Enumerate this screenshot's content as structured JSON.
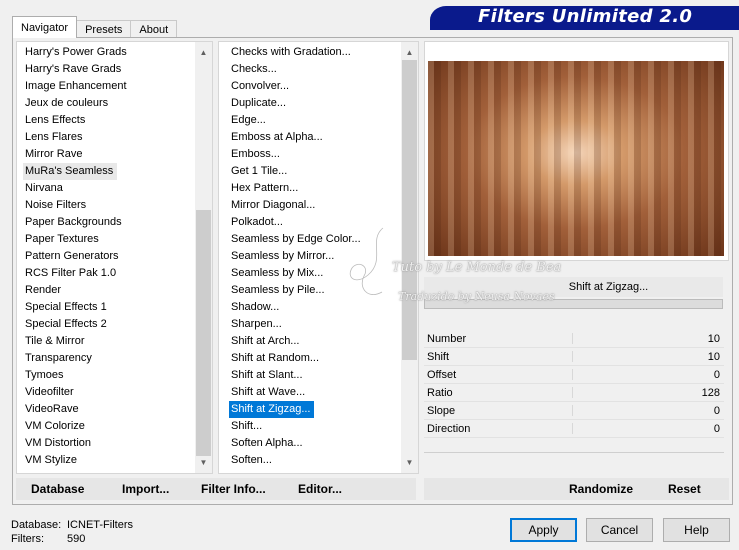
{
  "tabs": [
    "Navigator",
    "Presets",
    "About"
  ],
  "header_title": "Filters Unlimited 2.0",
  "categories": [
    "Harry's Power Grads",
    "Harry's Rave Grads",
    "Image Enhancement",
    "Jeux de couleurs",
    "Lens Effects",
    "Lens Flares",
    "Mirror Rave",
    "MuRa's Seamless",
    "Nirvana",
    "Noise Filters",
    "Paper Backgrounds",
    "Paper Textures",
    "Pattern Generators",
    "RCS Filter Pak 1.0",
    "Render",
    "Special Effects 1",
    "Special Effects 2",
    "Tile & Mirror",
    "Transparency",
    "Tymoes",
    "Videofilter",
    "VideoRave",
    "VM Colorize",
    "VM Distortion",
    "VM Stylize"
  ],
  "selected_category": "MuRa's Seamless",
  "filters": [
    "Checks with Gradation...",
    "Checks...",
    "Convolver...",
    "Duplicate...",
    "Edge...",
    "Emboss at Alpha...",
    "Emboss...",
    "Get 1 Tile...",
    "Hex Pattern...",
    "Mirror Diagonal...",
    "Polkadot...",
    "Seamless by Edge Color...",
    "Seamless by Mirror...",
    "Seamless by Mix...",
    "Seamless by Pile...",
    "Shadow...",
    "Sharpen...",
    "Shift at Arch...",
    "Shift at Random...",
    "Shift at Slant...",
    "Shift at Wave...",
    "Shift at Zigzag...",
    "Shift...",
    "Soften Alpha...",
    "Soften..."
  ],
  "selected_filter": "Shift at Zigzag...",
  "filter_name": "Shift at Zigzag...",
  "params": [
    {
      "label": "Number",
      "value": "10"
    },
    {
      "label": "Shift",
      "value": "10"
    },
    {
      "label": "Offset",
      "value": "0"
    },
    {
      "label": "Ratio",
      "value": "128"
    },
    {
      "label": "Slope",
      "value": "0"
    },
    {
      "label": "Direction",
      "value": "0"
    }
  ],
  "toolbar": {
    "database": "Database",
    "import": "Import...",
    "filter_info": "Filter Info...",
    "editor": "Editor...",
    "randomize": "Randomize",
    "reset": "Reset"
  },
  "footer": {
    "database_label": "Database:",
    "database_value": "ICNET-Filters",
    "filters_label": "Filters:",
    "filters_value": "590"
  },
  "buttons": {
    "apply": "Apply",
    "cancel": "Cancel",
    "help": "Help"
  },
  "watermark": {
    "line1": "Tuto by Le Monde de Bea",
    "line2": "Traduzido by Neusa Novaes"
  },
  "colors": {
    "header_bg": "#0a1a8c",
    "selection": "#0078d7"
  }
}
